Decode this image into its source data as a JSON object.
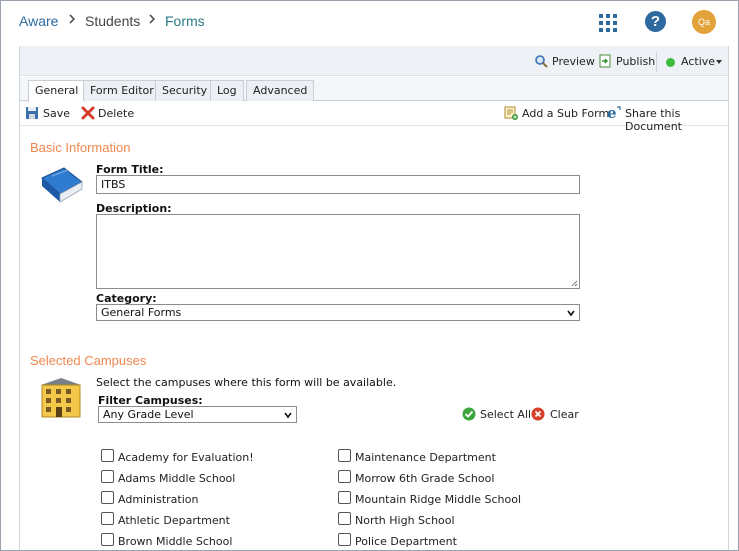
{
  "breadcrumb": {
    "items": [
      "Aware",
      "Students",
      "Forms"
    ]
  },
  "header": {
    "avatar_initials": "Qa"
  },
  "actions": {
    "preview": "Preview",
    "publish": "Publish",
    "status": "Active"
  },
  "tabs": [
    "General",
    "Form Editor",
    "Security",
    "Log",
    "Advanced"
  ],
  "toolbar": {
    "save": "Save",
    "delete": "Delete",
    "add_sub_form": "Add a Sub Form",
    "share": "Share this Document"
  },
  "basic_info": {
    "heading": "Basic Information",
    "form_title_label": "Form Title:",
    "form_title_value": "ITBS",
    "description_label": "Description:",
    "description_value": "",
    "category_label": "Category:",
    "category_value": "General Forms"
  },
  "campuses": {
    "heading": "Selected Campuses",
    "instructions": "Select the campuses where this form will be available.",
    "filter_label": "Filter Campuses:",
    "filter_value": "Any Grade Level",
    "select_all": "Select All",
    "clear": "Clear",
    "left": [
      "Academy for Evaluation!",
      "Adams Middle School",
      "Administration",
      "Athletic Department",
      "Brown Middle School"
    ],
    "right": [
      "Maintenance Department",
      "Morrow 6th Grade School",
      "Mountain Ridge Middle School",
      "North High School",
      "Police Department"
    ]
  },
  "colors": {
    "accent": "#2c6aa0",
    "section_heading": "#f0874e",
    "status_active": "#3dbb3d",
    "avatar_bg": "#e3a23a"
  }
}
